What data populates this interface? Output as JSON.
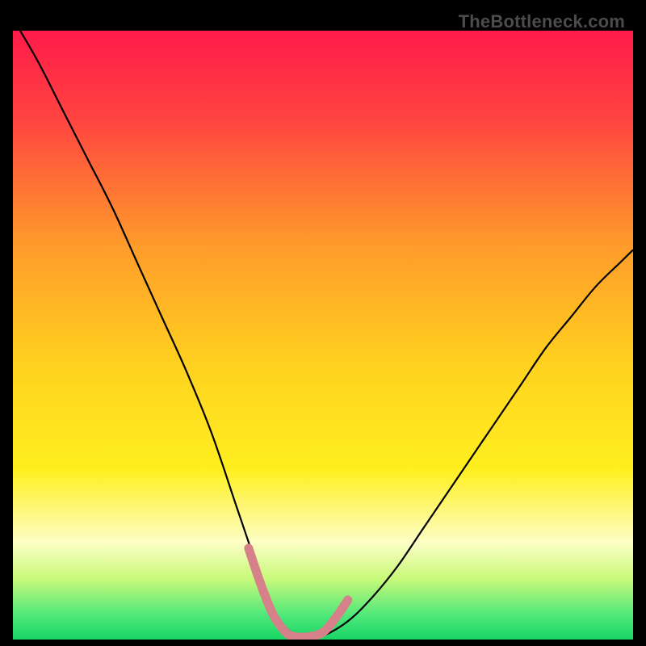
{
  "watermark": "TheBottleneck.com",
  "chart_data": {
    "type": "line",
    "title": "",
    "xlabel": "",
    "ylabel": "",
    "xlim": [
      0,
      100
    ],
    "ylim": [
      0,
      100
    ],
    "grid": false,
    "legend": false,
    "background_gradient": {
      "stops": [
        {
          "offset": 0.0,
          "color": "#ff1a4a"
        },
        {
          "offset": 0.15,
          "color": "#ff4640"
        },
        {
          "offset": 0.35,
          "color": "#ff9a2a"
        },
        {
          "offset": 0.55,
          "color": "#ffd21f"
        },
        {
          "offset": 0.72,
          "color": "#ffef1f"
        },
        {
          "offset": 0.84,
          "color": "#fdfec5"
        },
        {
          "offset": 0.9,
          "color": "#c8f97a"
        },
        {
          "offset": 0.96,
          "color": "#4fe87a"
        },
        {
          "offset": 1.0,
          "color": "#18d565"
        }
      ]
    },
    "series": [
      {
        "name": "bottleneck-curve",
        "stroke": "#000000",
        "stroke_width": 2.2,
        "x": [
          0,
          4,
          8,
          12,
          16,
          20,
          24,
          28,
          32,
          36,
          38,
          40,
          42,
          44,
          46,
          48,
          50,
          54,
          58,
          62,
          66,
          70,
          74,
          78,
          82,
          86,
          90,
          94,
          98,
          100
        ],
        "values": [
          102,
          95,
          87,
          79,
          71,
          62,
          53,
          44,
          34,
          22,
          16,
          10,
          5,
          2,
          0.6,
          0.4,
          0.6,
          3,
          7,
          12,
          18,
          24,
          30,
          36,
          42,
          48,
          53,
          58,
          62,
          64
        ]
      },
      {
        "name": "optimal-band",
        "stroke": "#d6818a",
        "stroke_width": 11,
        "linecap": "round",
        "x": [
          38,
          40,
          42,
          44,
          45,
          46,
          47,
          48,
          50,
          52,
          54
        ],
        "values": [
          15,
          9,
          4,
          1.2,
          0.6,
          0.4,
          0.4,
          0.5,
          1.2,
          3.5,
          6.5
        ]
      }
    ]
  }
}
